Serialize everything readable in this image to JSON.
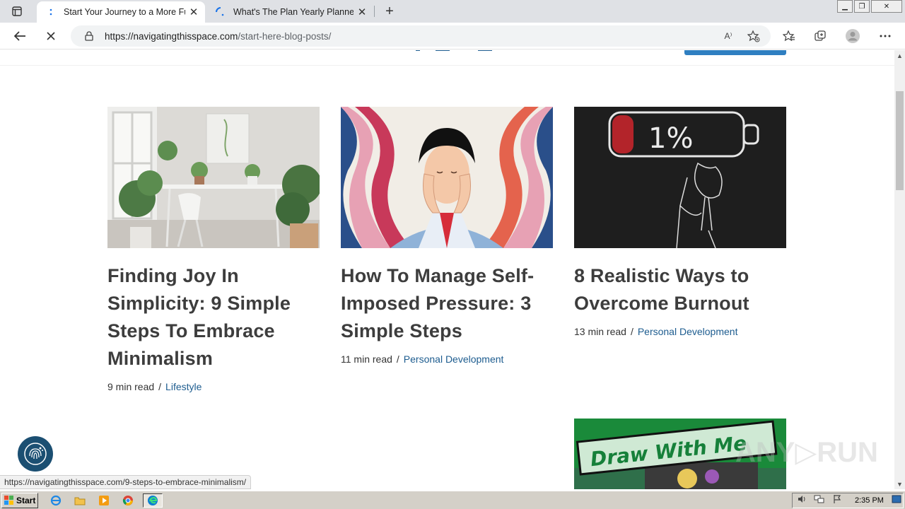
{
  "browser": {
    "tabs": [
      {
        "title": "Start Your Journey to a More Ful",
        "active": true
      },
      {
        "title": "What's The Plan Yearly Planner",
        "active": false
      }
    ],
    "address": {
      "host": "https://navigatingthisspace.com",
      "path": "/start-here-blog-posts/"
    },
    "read_aloud_label": "A⁾"
  },
  "posts": [
    {
      "title": "Finding Joy In Simplicity: 9 Simple Steps To Embrace Minimalism",
      "read_time": "9 min read",
      "separator": "/",
      "category": "Lifestyle"
    },
    {
      "title": "How To Manage Self-Imposed Pressure: 3 Simple Steps",
      "read_time": "11 min read",
      "separator": "/",
      "category": "Personal Development"
    },
    {
      "title": "8 Realistic Ways to Overcome Burnout",
      "read_time": "13 min read",
      "separator": "/",
      "category": "Personal Development"
    }
  ],
  "burnout_image_text": "1%",
  "next_post_image_text": "Draw With Me",
  "status_url": "https://navigatingthisspace.com/9-steps-to-embrace-minimalism/",
  "watermark": "ANY▷RUN",
  "taskbar": {
    "start_label": "Start",
    "clock": "2:35 PM"
  },
  "colors": {
    "category_link": "#1d5c8f",
    "heading": "#3d3d3d",
    "accent_button": "#2f7fc1"
  }
}
